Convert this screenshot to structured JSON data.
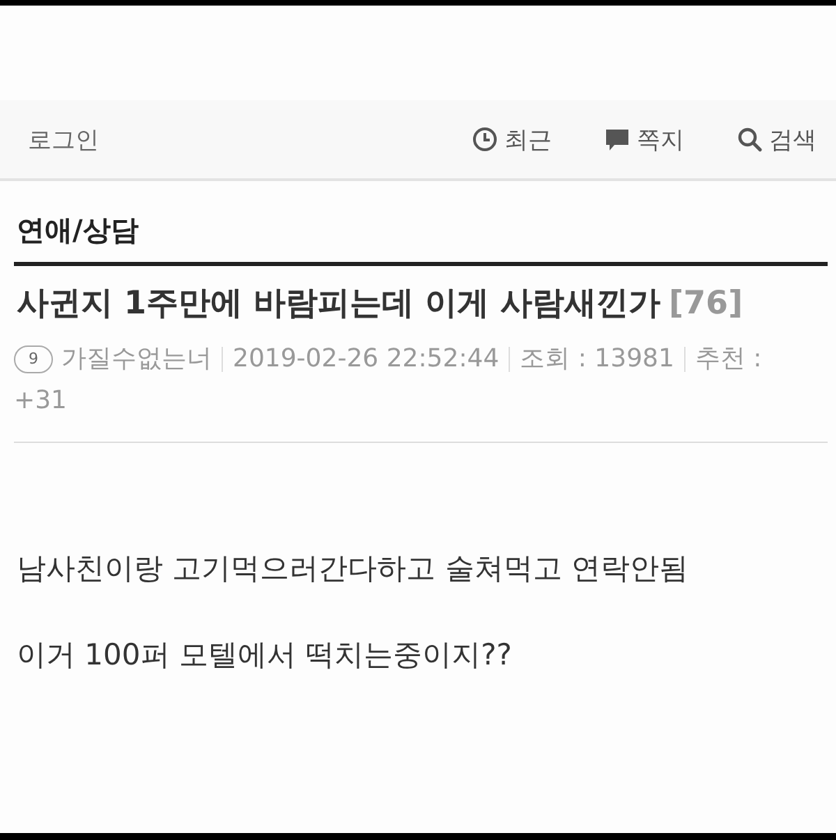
{
  "nav": {
    "login": "로그인",
    "items": [
      {
        "kind": "recent",
        "label": "최근"
      },
      {
        "kind": "message",
        "label": "쪽지"
      },
      {
        "kind": "search",
        "label": "검색"
      }
    ]
  },
  "board": {
    "name": "연애/상담"
  },
  "post": {
    "title": "사귄지 1주만에 바람피는데 이게 사람새낀가",
    "comment_count": "[76]",
    "author_level": "9",
    "author": "가질수없는너",
    "datetime": "2019-02-26 22:52:44",
    "views": "조회 : 13981",
    "recommend_label": "추천 :",
    "recommend_value": "+31",
    "body": [
      "남사친이랑 고기먹으러간다하고 술쳐먹고 연락안됨",
      "이거 100퍼 모텔에서 떡치는중이지??"
    ]
  }
}
